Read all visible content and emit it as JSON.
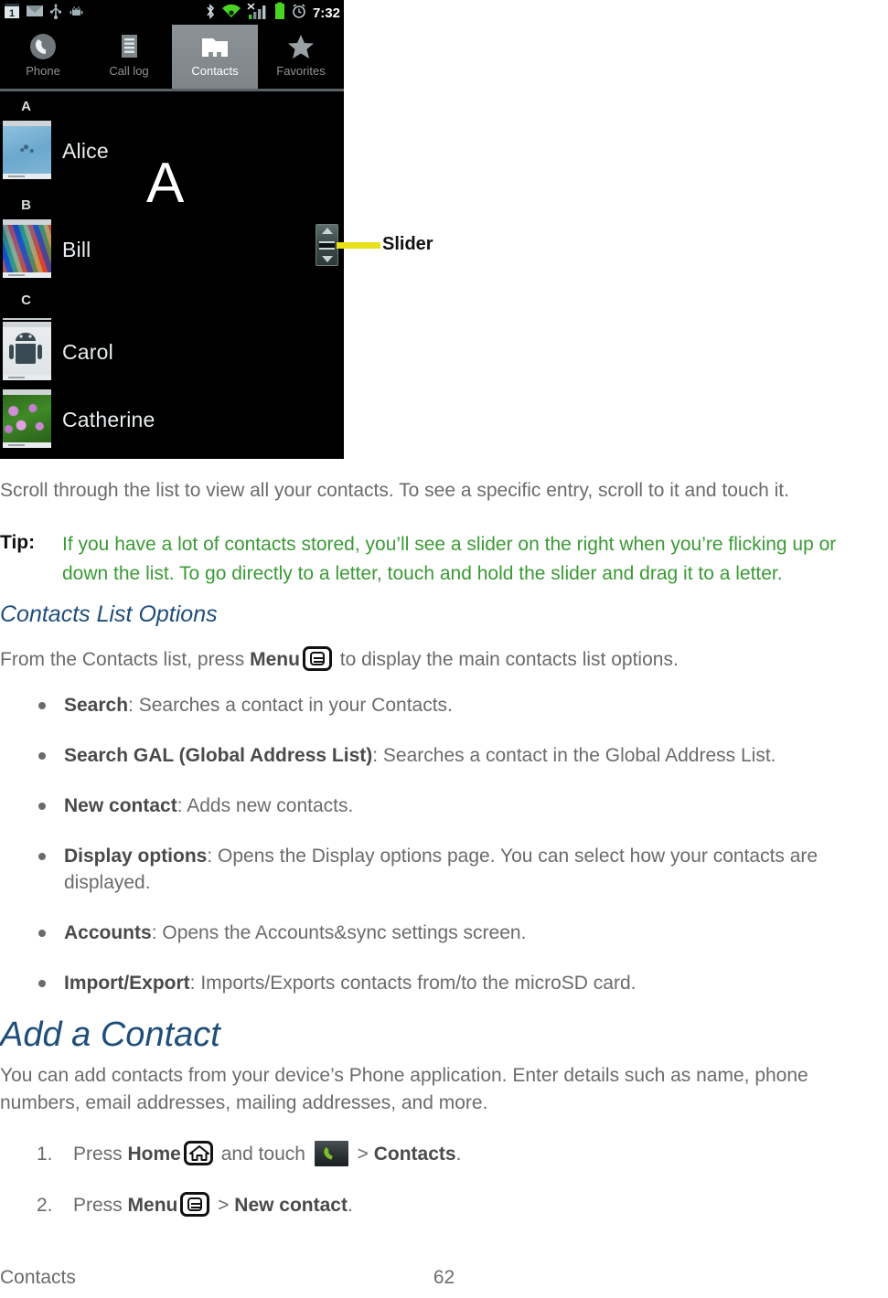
{
  "screenshot": {
    "status_bar": {
      "left_icons": [
        "calendar-icon",
        "email-icon",
        "usb-icon",
        "android-debug-icon"
      ],
      "calendar_day": "1",
      "right_icons": [
        "bluetooth-icon",
        "wifi-icon",
        "signal-icon",
        "battery-icon",
        "alarm-icon"
      ],
      "time": "7:32"
    },
    "tabs": [
      {
        "label": "Phone",
        "icon": "phone-icon",
        "active": false
      },
      {
        "label": "Call log",
        "icon": "call-log-icon",
        "active": false
      },
      {
        "label": "Contacts",
        "icon": "contacts-icon",
        "active": true
      },
      {
        "label": "Favorites",
        "icon": "star-icon",
        "active": false
      }
    ],
    "section_headers": [
      "A",
      "B",
      "C"
    ],
    "contacts": [
      {
        "name": "Alice",
        "section": "A"
      },
      {
        "name": "Bill",
        "section": "B"
      },
      {
        "name": "Carol",
        "section": "C"
      },
      {
        "name": "Catherine",
        "section": "C"
      }
    ],
    "overlay_letter": "A",
    "slider": {
      "present": true,
      "up_arrow": "▲",
      "down_arrow": "▼"
    },
    "callout": {
      "label": "Slider",
      "line_color": "#e8e119"
    }
  },
  "content": {
    "scroll_paragraph": "Scroll through the list to view all your contacts. To see a specific entry, scroll to it and touch it.",
    "tip": {
      "label": "Tip:",
      "text": "If you have a lot of contacts stored, you’ll see a slider on the right when you’re flicking up or down the list. To go directly to a letter, touch and hold the slider and drag it to a letter.",
      "color": "#3a9a35"
    },
    "section_heading": "Contacts List Options",
    "menu_intro": {
      "before": "From the Contacts list, press ",
      "bold": "Menu",
      "icon": "menu-key-icon",
      "after": " to display the main contacts list options."
    },
    "options": [
      {
        "term": "Search",
        "desc": ": Searches a contact in your Contacts."
      },
      {
        "term": "Search GAL (Global Address List)",
        "desc": ": Searches a contact in the Global Address List."
      },
      {
        "term": "New contact",
        "desc": ": Adds new contacts."
      },
      {
        "term": "Display options",
        "desc": ": Opens the Display options page. You can select how your contacts are displayed."
      },
      {
        "term": "Accounts",
        "desc": ": Opens the Accounts&sync settings screen."
      },
      {
        "term": "Import/Export",
        "desc": ": Imports/Exports contacts from/to the microSD card."
      }
    ],
    "add_heading": "Add a Contact",
    "add_intro": "You can add contacts from your device’s Phone application. Enter details such as name, phone numbers, email addresses, mailing addresses, and more.",
    "steps": [
      {
        "num": "1.",
        "p1": "Press ",
        "b1": "Home",
        "icon1": "home-key-icon",
        "p2": " and touch ",
        "icon2": "phone-app-icon",
        "p3": " > ",
        "b2": "Contacts",
        "p4": "."
      },
      {
        "num": "2.",
        "p1": "Press ",
        "b1": "Menu",
        "icon1": "menu-key-icon",
        "p2": " > ",
        "b2": "New contact",
        "p3": "."
      }
    ],
    "heading_color": "#1f4e79"
  },
  "footer": {
    "left": "Contacts",
    "page": "62"
  }
}
